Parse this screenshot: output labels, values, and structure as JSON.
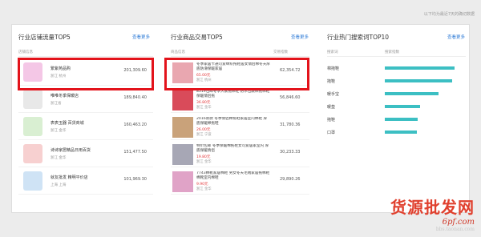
{
  "top_note": "以下均为最近7天的确切数据",
  "stores": {
    "title": "行业店铺流量TOP5",
    "more": "查看更多",
    "headers": {
      "info": "店铺信息",
      "value": "访客数"
    },
    "rows": [
      {
        "name": "繁紫苑品购",
        "loc": "浙江 杭州",
        "value": "201,309.60",
        "color": "#f4c7e6"
      },
      {
        "name": "唯唯冬季保暖店",
        "loc": "浙江省",
        "value": "189,840.40",
        "color": "#e8e8e8"
      },
      {
        "name": "表表玉器 百货商城",
        "loc": "浙江 金华",
        "value": "160,463.20",
        "color": "#d9efd2"
      },
      {
        "name": "诗诗家居精品日用百货",
        "loc": "浙江 金华",
        "value": "151,477.50",
        "color": "#f7d0d0"
      },
      {
        "name": "就友批发 精明平价店",
        "loc": "上海 上海",
        "value": "101,969.30",
        "color": "#cfe3f5"
      }
    ]
  },
  "products": {
    "title": "行业商品交易TOP5",
    "more": "查看更多",
    "headers": {
      "info": "商品信息",
      "value": "交易指数"
    },
    "rows": [
      {
        "title": "冬季家居卡通可爱绵织拖鞋居女情侣棉冬天厚底防滑保暖家居",
        "price": "65.00元",
        "loc": "浙江 杭州",
        "value": "62,354.72",
        "color": "#e9a7b0"
      },
      {
        "title": "8519包邮冬季大家拖棉鞋 防水包跟棉拖棉鞋保暖情侣拖",
        "price": "36.80元",
        "loc": "浙江 金华",
        "value": "56,846.60",
        "color": "#d94b5a"
      },
      {
        "title": "2016新款 冬季情侣棉拖鞋家居室内棉鞋 厚底保暖棉拖鞋",
        "price": "26.00元",
        "loc": "浙江 宁波",
        "value": "31,780.36",
        "color": "#c9a27a"
      },
      {
        "title": "特价包邮 冬季保暖棉拖鞋女可爱居家室内 厚底保暖情侣",
        "price": "19.80元",
        "loc": "浙江 金华",
        "value": "30,233.33",
        "color": "#a7a7b5"
      },
      {
        "title": "7743棉靴家居棉鞋 男女冬天毛绒家居拖棉鞋 棉靴室内棉鞋",
        "price": "9.90元",
        "loc": "浙江 金华",
        "value": "29,890.26",
        "color": "#e0a3c7"
      }
    ]
  },
  "keywords": {
    "title": "行业热门搜索词TOP10",
    "more": "查看更多",
    "headers": {
      "word": "搜索词",
      "index": "搜索指数"
    },
    "rows": [
      {
        "word": "棉拖鞋",
        "level": 0.92
      },
      {
        "word": "拖鞋",
        "level": 0.88
      },
      {
        "word": "暖手宝",
        "level": 0.71
      },
      {
        "word": "暖垫",
        "level": 0.46
      },
      {
        "word": "拖鞋",
        "level": 0.43
      },
      {
        "word": "口罩",
        "level": 0.42
      }
    ]
  },
  "watermark": {
    "big": "货源批发网",
    "site": "6pf.com",
    "site2": "bbs.taonan.com"
  },
  "accent": "#2e7bd6",
  "highlight": "#e3131b"
}
